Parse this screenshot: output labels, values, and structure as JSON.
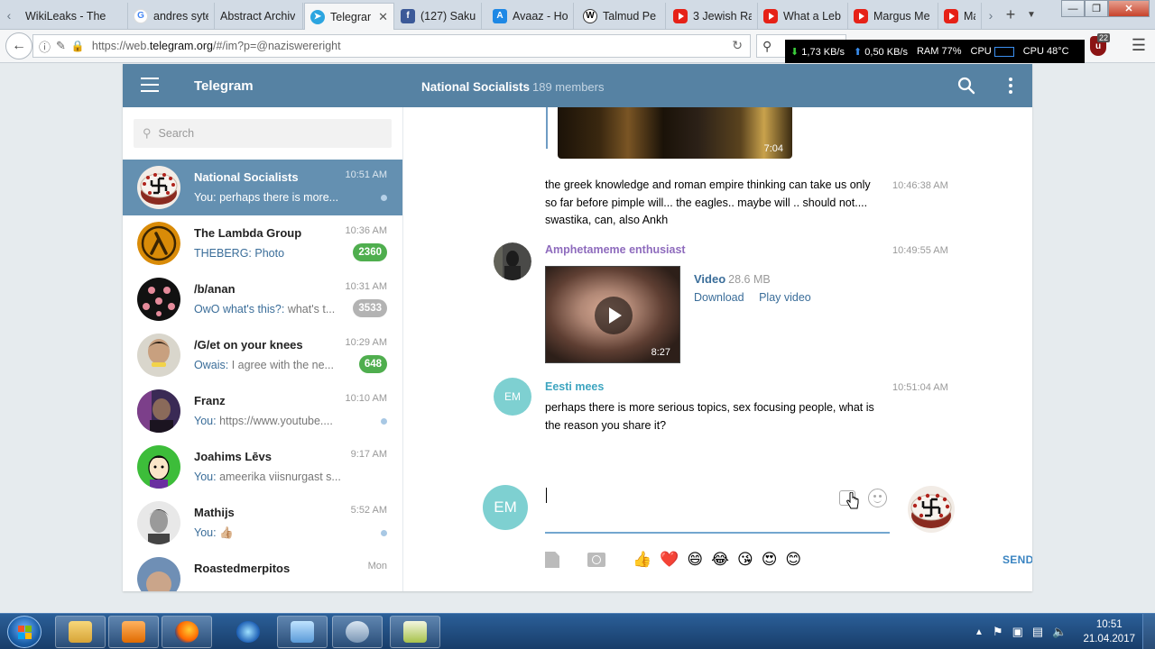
{
  "browser": {
    "tabs": [
      {
        "title": "WikiLeaks - The",
        "icon": "none"
      },
      {
        "title": "andres syte",
        "icon": "google-icon"
      },
      {
        "title": "Abstract Archiv",
        "icon": "none"
      },
      {
        "title": "Telegram",
        "icon": "telegram-icon"
      },
      {
        "title": "(127) Sakur",
        "icon": "facebook-icon"
      },
      {
        "title": "Avaaz - Ho",
        "icon": "avaaz-icon"
      },
      {
        "title": "Talmud Pe",
        "icon": "wikipedia-icon"
      },
      {
        "title": "3 Jewish Ra",
        "icon": "youtube-icon"
      },
      {
        "title": "What a Leb",
        "icon": "youtube-icon"
      },
      {
        "title": "Margus Me",
        "icon": "youtube-icon"
      },
      {
        "title": "Ma",
        "icon": "youtube-icon"
      }
    ],
    "url_prefix": "https://web.",
    "url_domain": "telegram.org",
    "url_suffix": "/#/im?p=@naziswereright",
    "ublock_count": "22",
    "new_tab_icon": "+",
    "window_controls": [
      "minimize",
      "maximize",
      "close"
    ]
  },
  "sysmon": {
    "download": "1,73 KB/s",
    "upload": "0,50 KB/s",
    "ram": "RAM 77%",
    "cpu_label": "CPU",
    "cpu_temp": "CPU 48°C"
  },
  "telegram": {
    "app_title": "Telegram",
    "chat_title": "National Socialists",
    "chat_members": "189 members",
    "search_placeholder": "Search",
    "dialogs": [
      {
        "name": "National Socialists",
        "time": "10:51 AM",
        "sender": "You:",
        "message": "perhaps there is more...",
        "badge": "",
        "selected": true
      },
      {
        "name": "The Lambda Group",
        "time": "10:36 AM",
        "sender": "THEBERG:",
        "message": "Photo",
        "badge": "2360",
        "badge_color": "green"
      },
      {
        "name": "/b/anan",
        "time": "10:31 AM",
        "sender": "OwO what's this?:",
        "message": "what's t...",
        "badge": "3533",
        "badge_color": "grey"
      },
      {
        "name": "/G/et on your knees",
        "time": "10:29 AM",
        "sender": "Owais:",
        "message": "I agree with the ne...",
        "badge": "648",
        "badge_color": "green"
      },
      {
        "name": "Franz",
        "time": "10:10 AM",
        "sender": "You:",
        "message": "https://www.youtube....",
        "badge": ""
      },
      {
        "name": "Joahims Lēvs",
        "time": "9:17 AM",
        "sender": "You:",
        "message": "ameerika viisnurgast s...",
        "badge": ""
      },
      {
        "name": "Mathijs",
        "time": "5:52 AM",
        "sender": "You:",
        "message": "👍🏼",
        "badge": ""
      },
      {
        "name": "Roastedmerpitos",
        "time": "Mon",
        "sender": "",
        "message": "",
        "badge": ""
      }
    ],
    "messages": {
      "top_video_duration": "7:04",
      "msg1_text": "the greek knowledge and roman empire thinking can take us only so far before pimple will... the eagles.. maybe will .. should not.... swastika, can, also Ankh",
      "msg1_time": "10:46:38 AM",
      "msg2_author": "Amphetameme enthusiast",
      "msg2_time": "10:49:55 AM",
      "msg2_author_color": "#8e6bbd",
      "video_label": "Video",
      "video_size": "28.6 MB",
      "video_download": "Download",
      "video_play": "Play video",
      "video_duration": "8:27",
      "msg3_author": "Eesti mees",
      "msg3_author_color": "#3ea5c0",
      "msg3_avatar_initials": "EM",
      "msg3_time": "10:51:04 AM",
      "msg3_text": "perhaps there is more serious topics, sex focusing people, what is the reason you share it?"
    },
    "composer": {
      "avatar_initials": "EM",
      "send_label": "SEND",
      "quick_emojis": [
        "👍",
        "❤️",
        "😄",
        "😂",
        "😘",
        "😍",
        "😊"
      ]
    }
  },
  "taskbar": {
    "clock_time": "10:51",
    "clock_date": "21.04.2017"
  },
  "colors": {
    "header": "#5682a3",
    "selected_dialog": "#6490b1",
    "link": "#3a6d99",
    "badge_green": "#4fae4e",
    "badge_grey": "#b3b3b3"
  }
}
